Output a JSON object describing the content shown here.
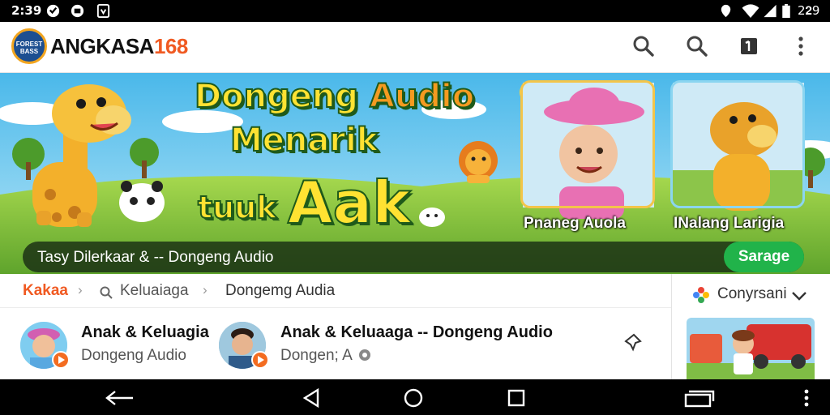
{
  "status_bar": {
    "time": "2:39",
    "battery": "2𝟐9"
  },
  "app": {
    "name_main": "ANGKASA",
    "name_num": "168",
    "logo_text": "FOREST BASS"
  },
  "hero": {
    "title_line1_a": "Dongeng ",
    "title_line1_b": "Audio",
    "title_line2": "Menarik",
    "title_line3_a": "tuuk ",
    "title_line3_b": "Aak",
    "card1_label": "Pnaneg Auola",
    "card2_label": "INalang Larigia",
    "play_text": "Tasy Dilerkaar & -- Dongeng Audio",
    "play_button": "Sarage"
  },
  "tabs": [
    {
      "label": "Kakaa"
    },
    {
      "label": "Keluaiaga"
    },
    {
      "label": "Dongemg Audia"
    }
  ],
  "list": [
    {
      "title": "Anak & Keluagia",
      "subtitle": "Dongeng Audio"
    },
    {
      "title": "Anak & Keluaaga -- Dongeng Audio",
      "subtitle": "Dongen; A"
    }
  ],
  "side_panel": {
    "title": "Conyrsani"
  },
  "colors": {
    "accent": "#f05a22",
    "play_button": "#21b34a",
    "status_bar": "#000000"
  }
}
